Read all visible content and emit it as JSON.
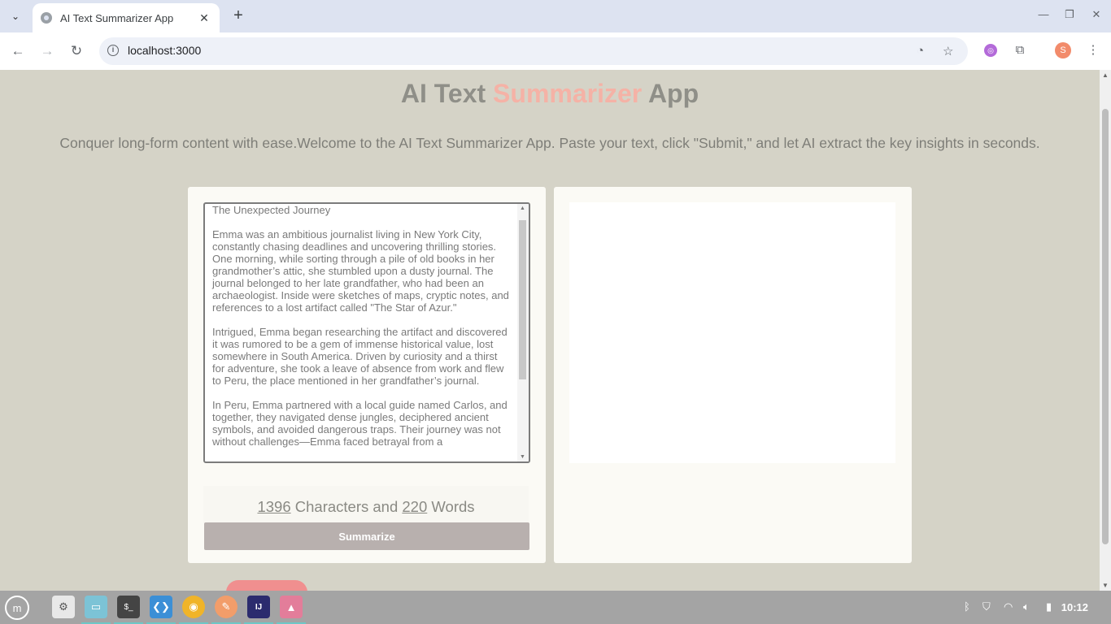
{
  "browser": {
    "tab_title": "AI Text Summarizer App",
    "tab_close": "✕",
    "new_tab": "+",
    "url": "localhost:3000",
    "profile_initial": "S"
  },
  "app": {
    "title_part1": "AI Text ",
    "title_accent": "Summarizer",
    "title_part3": " App",
    "subtitle": "Conquer long-form content with ease.Welcome to the AI Text Summarizer App. Paste your text, click \"Submit,\" and let AI extract the key insights in seconds.",
    "input_text": "The Unexpected Journey\n\nEmma was an ambitious journalist living in New York City, constantly chasing deadlines and uncovering thrilling stories. One morning, while sorting through a pile of old books in her grandmother’s attic, she stumbled upon a dusty journal. The journal belonged to her late grandfather, who had been an archaeologist. Inside were sketches of maps, cryptic notes, and references to a lost artifact called \"The Star of Azur.\"\n\nIntrigued, Emma began researching the artifact and discovered it was rumored to be a gem of immense historical value, lost somewhere in South America. Driven by curiosity and a thirst for adventure, she took a leave of absence from work and flew to Peru, the place mentioned in her grandfather’s journal.\n\nIn Peru, Emma partnered with a local guide named Carlos, and together, they navigated dense jungles, deciphered ancient symbols, and avoided dangerous traps. Their journey was not without challenges—Emma faced betrayal from a",
    "char_count": "1396",
    "chars_label": " Characters and ",
    "word_count": "220",
    "words_label": " Words",
    "summarize_label": "Summarize"
  },
  "taskbar": {
    "terminal_glyph": "$_",
    "ide_label": "IJ",
    "clock": "10:12"
  },
  "colors": {
    "accent": "#f5b2a6",
    "page_bg": "#d5d3c7",
    "panel_bg": "#fbfaf5",
    "button_bg": "#b8b0ae"
  }
}
